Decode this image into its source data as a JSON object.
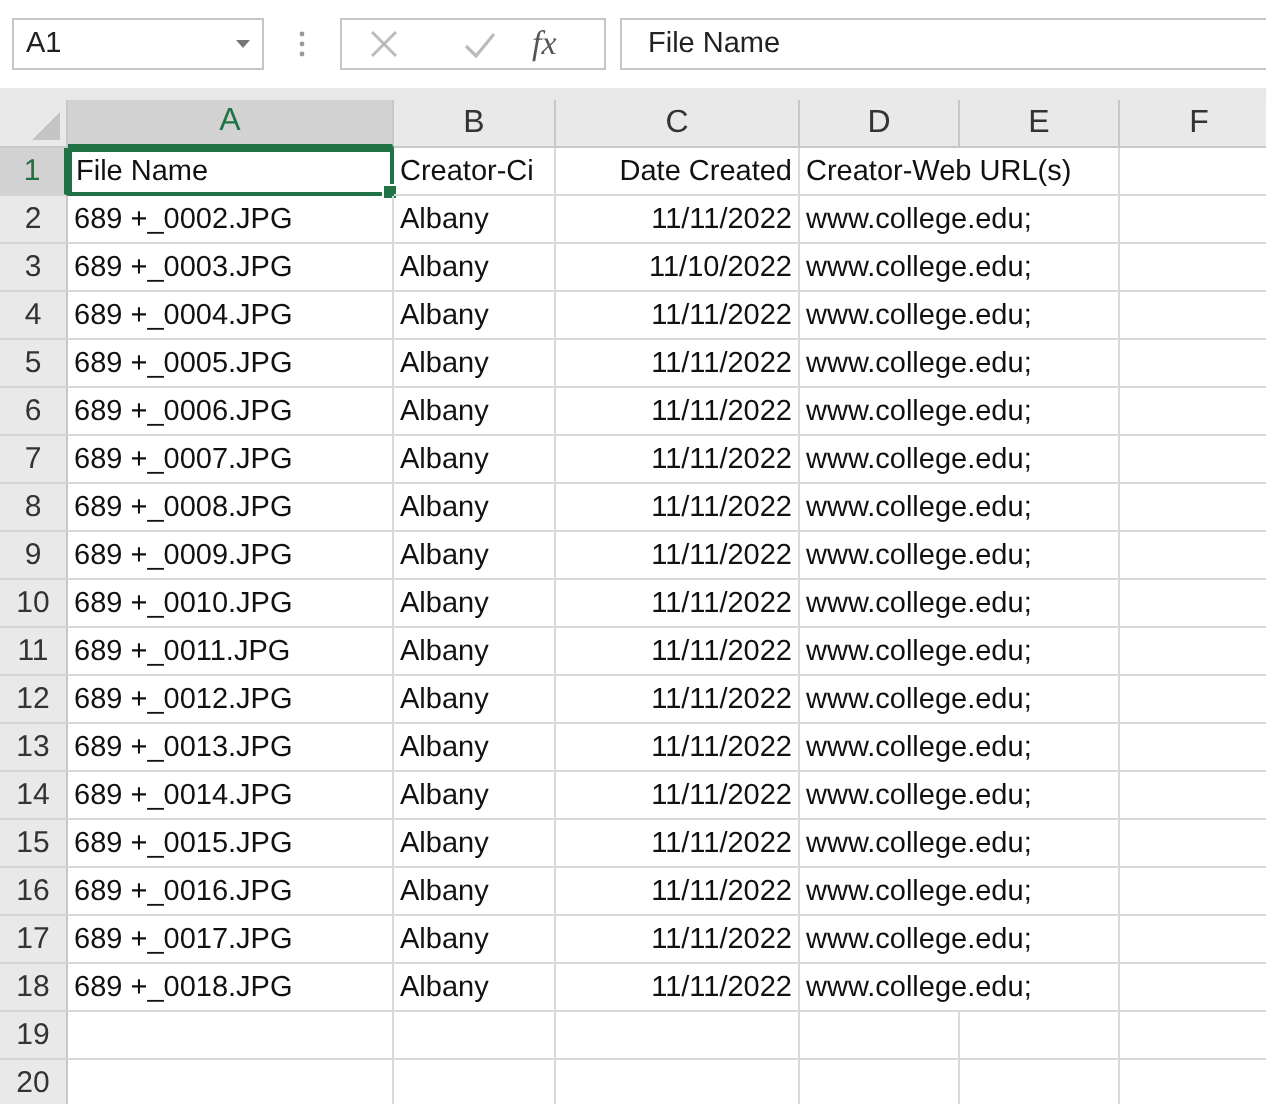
{
  "name_box": {
    "value": "A1"
  },
  "formula_bar": {
    "function_symbol": "fx",
    "value": "File Name"
  },
  "sheet": {
    "columns": [
      {
        "label": "A",
        "selected": true
      },
      {
        "label": "B",
        "selected": false
      },
      {
        "label": "C",
        "selected": false
      },
      {
        "label": "D",
        "selected": false
      },
      {
        "label": "E",
        "selected": false
      },
      {
        "label": "F",
        "selected": false
      }
    ],
    "rows": [
      {
        "number": "1",
        "selected": true,
        "cells": [
          "File Name",
          "Creator-Ci",
          "Date Created",
          "Creator-Web URL(s)"
        ]
      },
      {
        "number": "2",
        "selected": false,
        "cells": [
          "689 +_0002.JPG",
          "Albany",
          "11/11/2022",
          "www.college.edu;"
        ]
      },
      {
        "number": "3",
        "selected": false,
        "cells": [
          "689 +_0003.JPG",
          "Albany",
          "11/10/2022",
          "www.college.edu;"
        ]
      },
      {
        "number": "4",
        "selected": false,
        "cells": [
          "689 +_0004.JPG",
          "Albany",
          "11/11/2022",
          "www.college.edu;"
        ]
      },
      {
        "number": "5",
        "selected": false,
        "cells": [
          "689 +_0005.JPG",
          "Albany",
          "11/11/2022",
          "www.college.edu;"
        ]
      },
      {
        "number": "6",
        "selected": false,
        "cells": [
          "689 +_0006.JPG",
          "Albany",
          "11/11/2022",
          "www.college.edu;"
        ]
      },
      {
        "number": "7",
        "selected": false,
        "cells": [
          "689 +_0007.JPG",
          "Albany",
          "11/11/2022",
          "www.college.edu;"
        ]
      },
      {
        "number": "8",
        "selected": false,
        "cells": [
          "689 +_0008.JPG",
          "Albany",
          "11/11/2022",
          "www.college.edu;"
        ]
      },
      {
        "number": "9",
        "selected": false,
        "cells": [
          "689 +_0009.JPG",
          "Albany",
          "11/11/2022",
          "www.college.edu;"
        ]
      },
      {
        "number": "10",
        "selected": false,
        "cells": [
          "689 +_0010.JPG",
          "Albany",
          "11/11/2022",
          "www.college.edu;"
        ]
      },
      {
        "number": "11",
        "selected": false,
        "cells": [
          "689 +_0011.JPG",
          "Albany",
          "11/11/2022",
          "www.college.edu;"
        ]
      },
      {
        "number": "12",
        "selected": false,
        "cells": [
          "689 +_0012.JPG",
          "Albany",
          "11/11/2022",
          "www.college.edu;"
        ]
      },
      {
        "number": "13",
        "selected": false,
        "cells": [
          "689 +_0013.JPG",
          "Albany",
          "11/11/2022",
          "www.college.edu;"
        ]
      },
      {
        "number": "14",
        "selected": false,
        "cells": [
          "689 +_0014.JPG",
          "Albany",
          "11/11/2022",
          "www.college.edu;"
        ]
      },
      {
        "number": "15",
        "selected": false,
        "cells": [
          "689 +_0015.JPG",
          "Albany",
          "11/11/2022",
          "www.college.edu;"
        ]
      },
      {
        "number": "16",
        "selected": false,
        "cells": [
          "689 +_0016.JPG",
          "Albany",
          "11/11/2022",
          "www.college.edu;"
        ]
      },
      {
        "number": "17",
        "selected": false,
        "cells": [
          "689 +_0017.JPG",
          "Albany",
          "11/11/2022",
          "www.college.edu;"
        ]
      },
      {
        "number": "18",
        "selected": false,
        "cells": [
          "689 +_0018.JPG",
          "Albany",
          "11/11/2022",
          "www.college.edu;"
        ]
      },
      {
        "number": "19",
        "selected": false
      },
      {
        "number": "20",
        "selected": false
      }
    ]
  }
}
